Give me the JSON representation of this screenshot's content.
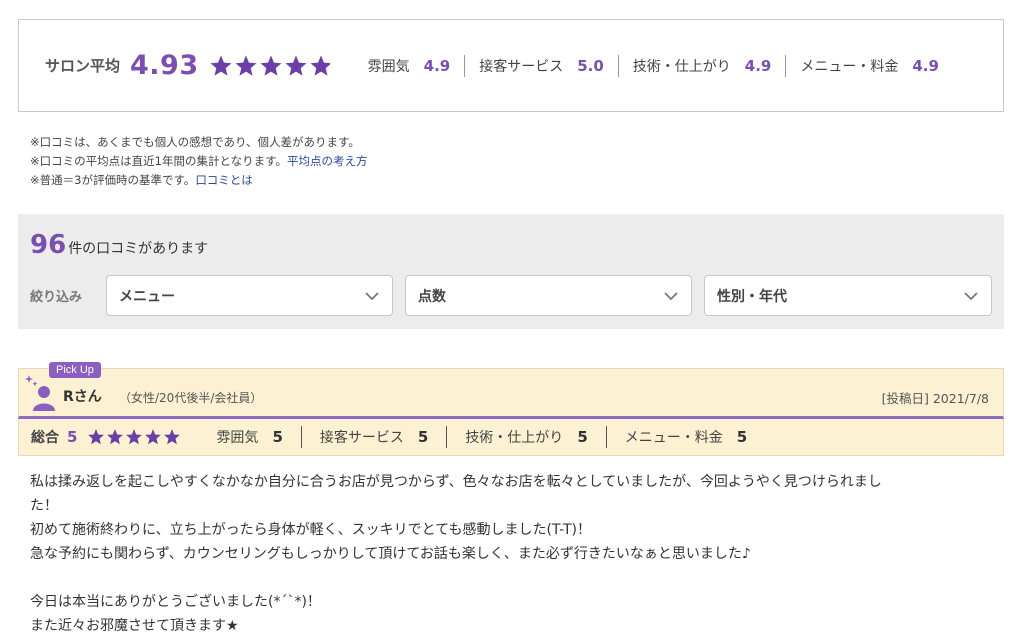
{
  "summary": {
    "label": "サロン平均",
    "score": "4.93",
    "stars": 4.93,
    "items": [
      {
        "label": "雰囲気",
        "value": "4.9"
      },
      {
        "label": "接客サービス",
        "value": "5.0"
      },
      {
        "label": "技術・仕上がり",
        "value": "4.9"
      },
      {
        "label": "メニュー・料金",
        "value": "4.9"
      }
    ]
  },
  "notes": {
    "line1": "※口コミは、あくまでも個人の感想であり、個人差があります。",
    "line2": "※口コミの平均点は直近1年間の集計となります。",
    "line2_link": "平均点の考え方",
    "line3": "※普通＝3が評価時の基準です。",
    "line3_link": "口コミとは"
  },
  "filter": {
    "count": "96",
    "count_suffix": "件の口コミがあります",
    "label": "絞り込み",
    "selects": [
      {
        "value": "メニュー"
      },
      {
        "value": "点数"
      },
      {
        "value": "性別・年代"
      }
    ]
  },
  "review": {
    "badge": "Pick Up",
    "name": "Rさん",
    "attributes": "（女性/20代後半/会社員）",
    "date": "[投稿日] 2021/7/8",
    "overall_label": "総合",
    "overall_value": "5",
    "stars": 5,
    "items": [
      {
        "label": "雰囲気",
        "value": "5"
      },
      {
        "label": "接客サービス",
        "value": "5"
      },
      {
        "label": "技術・仕上がり",
        "value": "5"
      },
      {
        "label": "メニュー・料金",
        "value": "5"
      }
    ],
    "body": [
      "私は揉み返しを起こしやすくなかなか自分に合うお店が見つからず、色々なお店を転々としていましたが、今回ようやく見つけられまし",
      "た！",
      "初めて施術終わりに、立ち上がったら身体が軽く、スッキリでとても感動しました(T-T)！",
      "急な予約にも関わらず、カウンセリングもしっかりして頂けてお話も楽しく、また必ず行きたいなぁと思いました♪",
      "",
      "今日は本当にありがとうございました(*´`*)！",
      "また近々お邪魔させて頂きます★"
    ]
  },
  "colors": {
    "accent": "#7a4fb0",
    "star": "#6b3fa5",
    "star_empty": "#d9d9d9",
    "header_bg": "#fdf1d4",
    "link": "#2a4a9b"
  }
}
